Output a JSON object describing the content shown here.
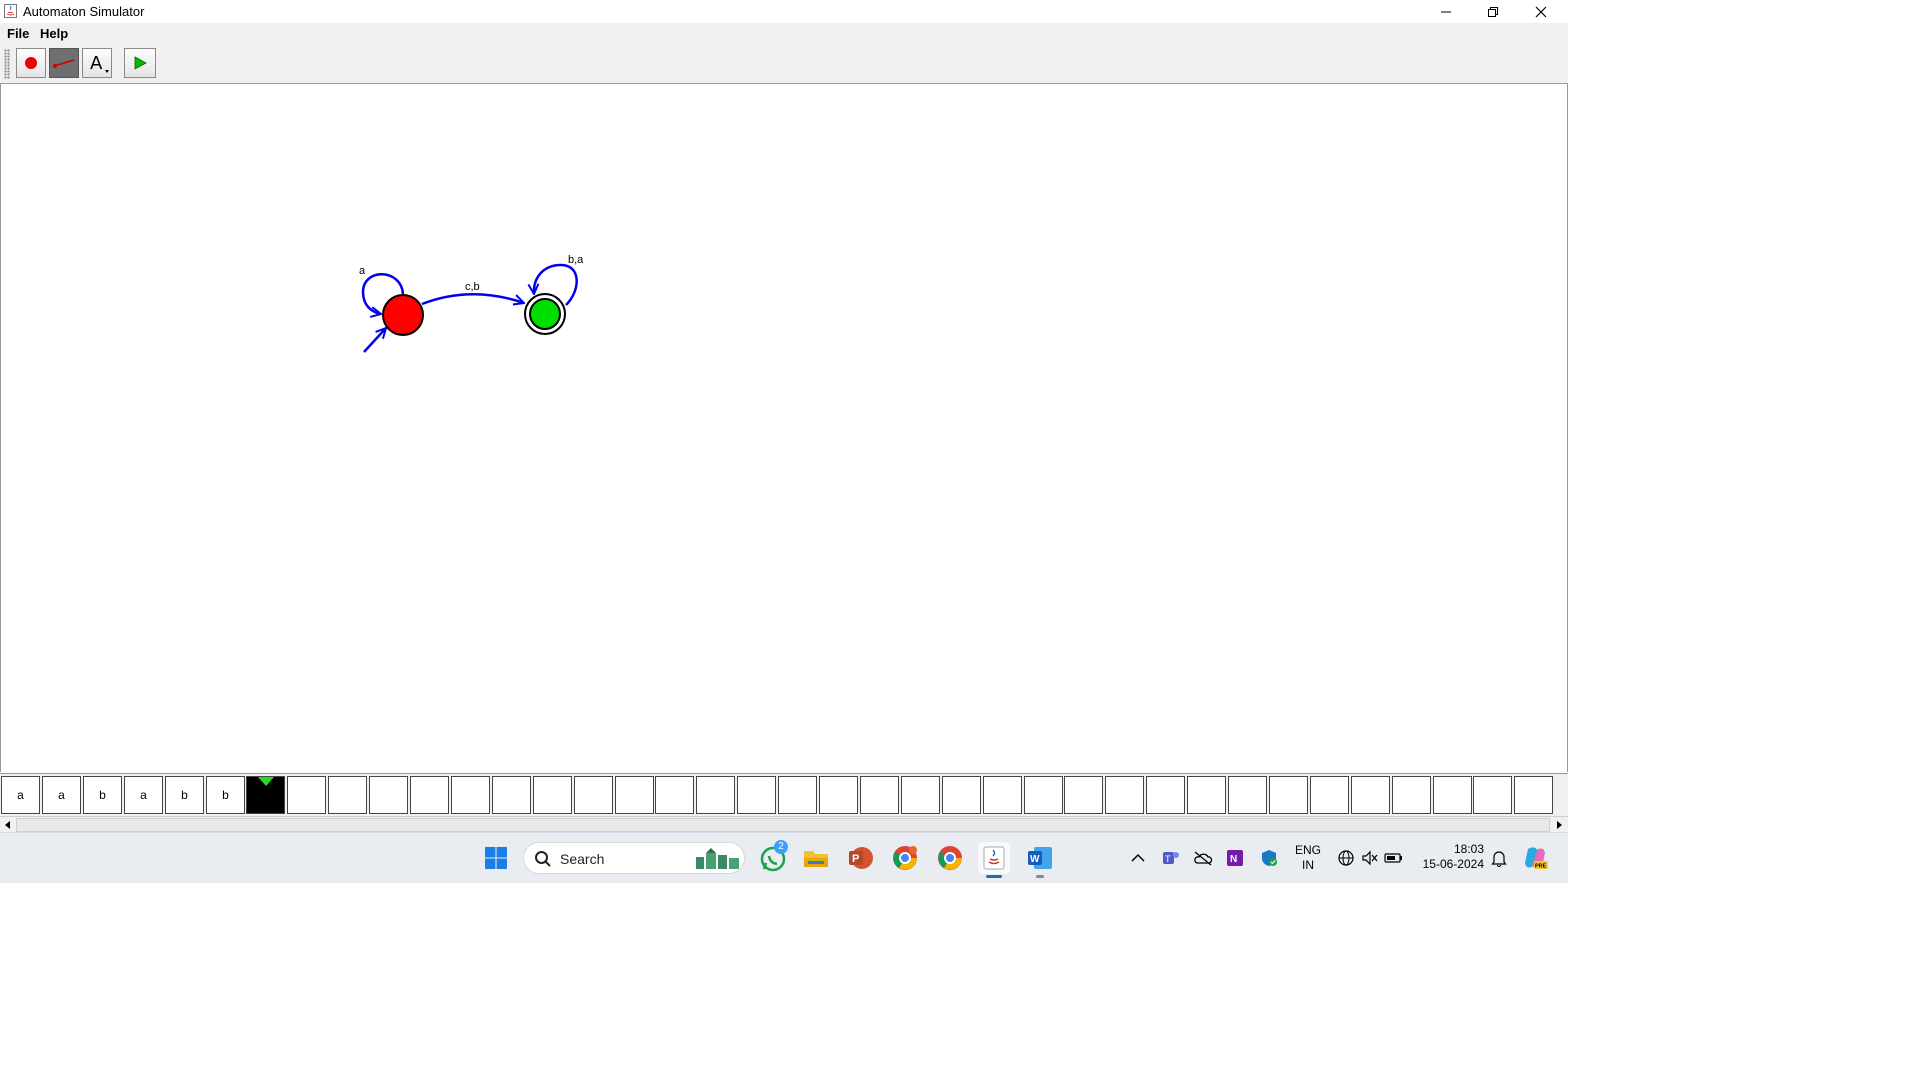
{
  "window": {
    "title": "Automaton Simulator"
  },
  "menu": {
    "file": "File",
    "help": "Help"
  },
  "toolbar": {
    "tools": [
      {
        "name": "add-state",
        "icon": "red-dot-icon"
      },
      {
        "name": "add-transition",
        "icon": "arrow-line-icon",
        "selected": true
      },
      {
        "name": "add-label",
        "icon": "letter-a-icon"
      },
      {
        "name": "run-simulation",
        "icon": "play-icon"
      }
    ]
  },
  "automaton": {
    "states": [
      {
        "id": "q0",
        "initial": true,
        "accepting": false,
        "color": "#ff0000"
      },
      {
        "id": "q1",
        "initial": false,
        "accepting": true,
        "color": "#00dd00"
      }
    ],
    "transitions": [
      {
        "from": "q0",
        "to": "q0",
        "label": "a"
      },
      {
        "from": "q0",
        "to": "q1",
        "label": "c,b"
      },
      {
        "from": "q1",
        "to": "q1",
        "label": "b,a"
      }
    ],
    "edge_color": "#0000ee"
  },
  "tape": {
    "cells": [
      "a",
      "a",
      "b",
      "a",
      "b",
      "b",
      "",
      "",
      "",
      "",
      "",
      "",
      "",
      "",
      "",
      "",
      "",
      "",
      "",
      "",
      "",
      "",
      "",
      "",
      "",
      "",
      "",
      "",
      "",
      "",
      "",
      "",
      "",
      "",
      "",
      "",
      "",
      ""
    ],
    "head_index": 6
  },
  "taskbar": {
    "search_placeholder": "Search",
    "whatsapp_badge": "2",
    "language_line1": "ENG",
    "language_line2": "IN",
    "time": "18:03",
    "date": "15-06-2024"
  }
}
